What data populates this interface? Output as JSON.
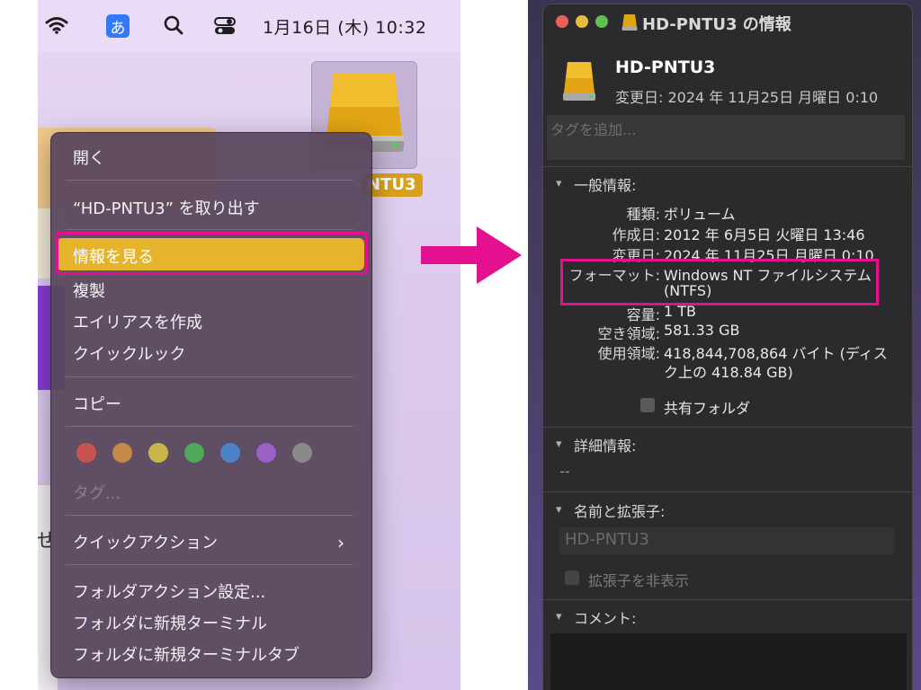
{
  "menubar": {
    "ime_label": "あ",
    "clock": "1月16日 (木)  10:32"
  },
  "desktop": {
    "drive_label": "NTU3",
    "strip_text": "せ"
  },
  "context_menu": {
    "open": "開く",
    "eject": "“HD-PNTU3” を取り出す",
    "get_info": "情報を見る",
    "duplicate": "複製",
    "make_alias": "エイリアスを作成",
    "quick_look": "クイックルック",
    "copy": "コピー",
    "tag_colors": [
      "#c8524f",
      "#c88a48",
      "#c9b548",
      "#4fa85b",
      "#4b83c8",
      "#9b5fc5",
      "#8a8a8a"
    ],
    "tags": "タグ...",
    "quick_actions": "クイックアクション",
    "quick_actions_chevron": "›",
    "folder_action_settings": "フォルダアクション設定...",
    "new_terminal": "フォルダに新規ターミナル",
    "new_terminal_tab": "フォルダに新規ターミナルタブ"
  },
  "info_window": {
    "title": "HD-PNTU3 の情報",
    "name": "HD-PNTU3",
    "modified_header": "変更日: 2024 年 11月25日 月曜日 0:10",
    "tags_placeholder": "タグを追加...",
    "general": {
      "title": "一般情報:",
      "rows": [
        {
          "k": "種類:",
          "v": "ボリューム"
        },
        {
          "k": "作成日:",
          "v": "2012 年 6月5日 火曜日 13:46"
        },
        {
          "k": "変更日:",
          "v": "2024 年 11月25日 月曜日 0:10"
        },
        {
          "k": "フォーマット:",
          "v": "Windows NT ファイルシステム"
        },
        {
          "k": "",
          "v": "(NTFS)"
        },
        {
          "k": "容量:",
          "v": "1 TB"
        },
        {
          "k": "空き領域:",
          "v": "581.33 GB"
        },
        {
          "k": "使用領域:",
          "v": "418,844,708,864 バイト (ディス"
        },
        {
          "k": "",
          "v": "ク上の 418.84 GB)"
        }
      ],
      "shared_folder": "共有フォルダ"
    },
    "more_info": {
      "title": "詳細情報:",
      "value": "--"
    },
    "name_ext": {
      "title": "名前と拡張子:",
      "value": "HD-PNTU3",
      "hide_ext": "拡張子を非表示"
    },
    "comments": {
      "title": "コメント:"
    }
  },
  "colors": {
    "highlight": "#e6b42c",
    "annotation": "#e4108f"
  }
}
